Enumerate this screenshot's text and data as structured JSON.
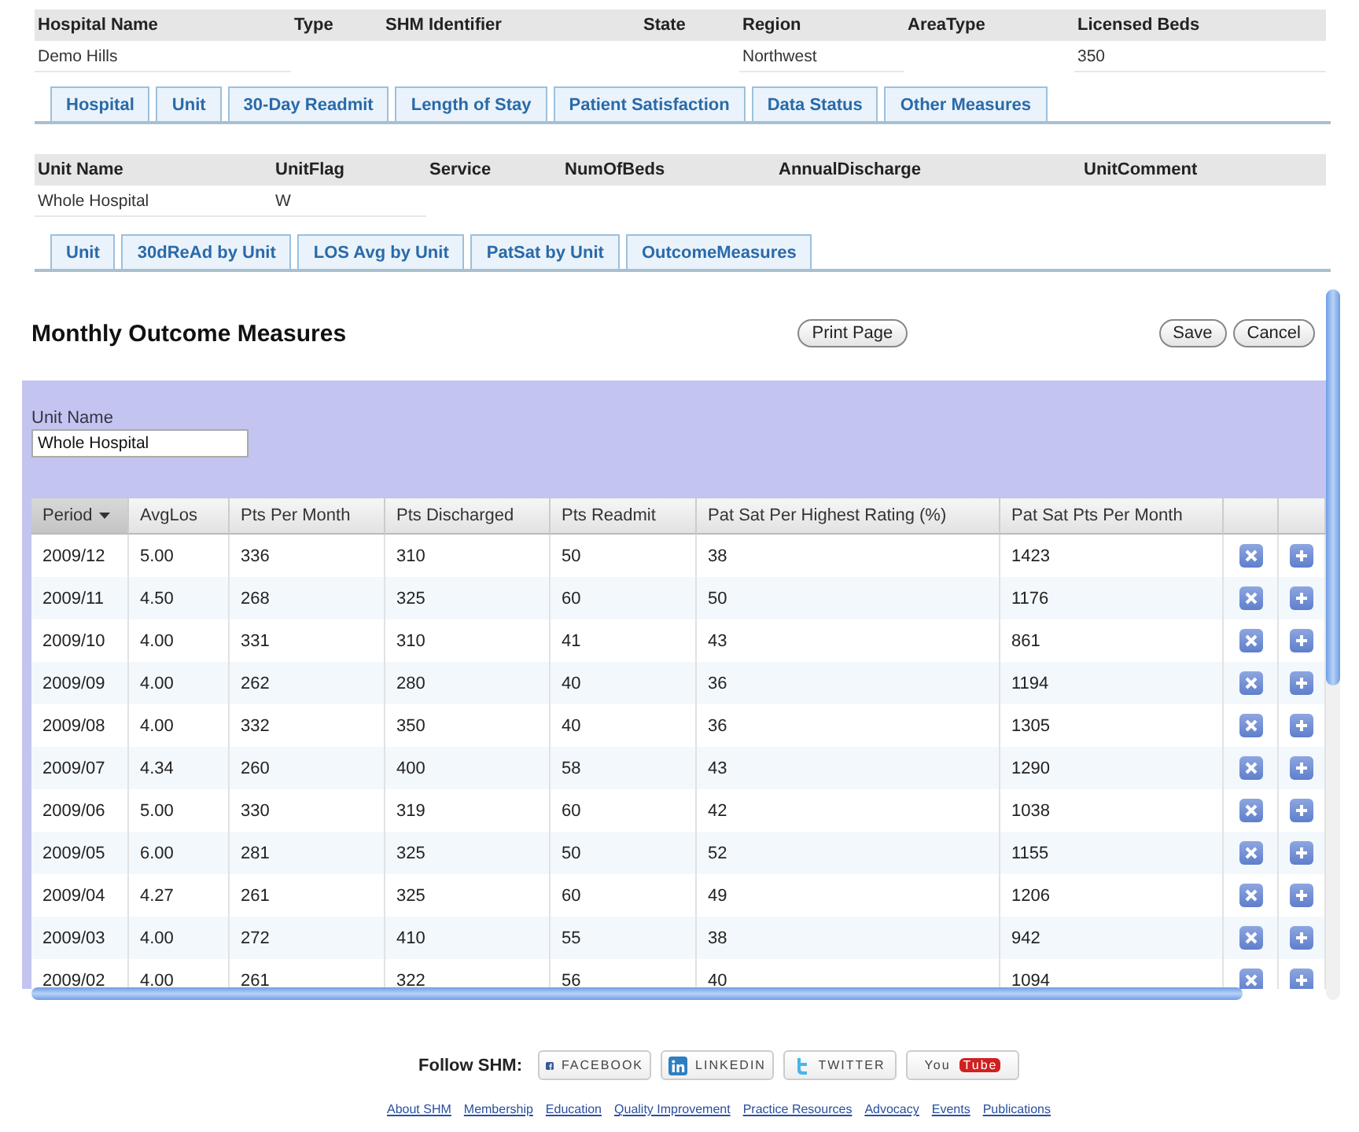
{
  "hospital": {
    "columns": [
      {
        "label": "Hospital Name",
        "value": "Demo Hills"
      },
      {
        "label": "Type"
      },
      {
        "label": "SHM Identifier"
      },
      {
        "label": "State"
      },
      {
        "label": "Region",
        "value": "Northwest"
      },
      {
        "label": "AreaType"
      },
      {
        "label": "Licensed Beds",
        "value": "350"
      }
    ]
  },
  "main_tabs": [
    {
      "label": "Hospital",
      "selected": false
    },
    {
      "label": "Unit",
      "selected": false
    },
    {
      "label": "30-Day Readmit",
      "selected": false
    },
    {
      "label": "Length of Stay",
      "selected": false
    },
    {
      "label": "Patient Satisfaction",
      "selected": false
    },
    {
      "label": "Data Status",
      "selected": false
    },
    {
      "label": "Other Measures",
      "selected": false
    }
  ],
  "unit": {
    "columns": [
      {
        "label": "Unit Name",
        "value": "Whole Hospital"
      },
      {
        "label": "UnitFlag",
        "value": "W"
      },
      {
        "label": "Service"
      },
      {
        "label": "NumOfBeds"
      },
      {
        "label": "AnnualDischarge"
      },
      {
        "label": "UnitComment"
      }
    ]
  },
  "unit_tabs": [
    {
      "label": "Unit",
      "selected": false
    },
    {
      "label": "30dReAd by Unit",
      "selected": false
    },
    {
      "label": "LOS Avg by Unit",
      "selected": false
    },
    {
      "label": "PatSat by Unit",
      "selected": false
    },
    {
      "label": "OutcomeMeasures",
      "selected": false
    }
  ],
  "panel": {
    "title": "Monthly Outcome Measures",
    "print_button": "Print Page",
    "buttons": [
      "Save",
      "Cancel"
    ],
    "unit_name_label": "Unit Name",
    "unit_name_value": "Whole Hospital",
    "table": {
      "columns": [
        {
          "label": "Period",
          "sorted": true
        },
        {
          "label": "AvgLos",
          "sorted": false
        },
        {
          "label": "Pts Per Month",
          "sorted": false
        },
        {
          "label": "Pts Discharged",
          "sorted": false
        },
        {
          "label": "Pts Readmit",
          "sorted": false
        },
        {
          "label": "Pat Sat Per Highest Rating (%)",
          "sorted": false
        },
        {
          "label": "Pat Sat Pts Per Month",
          "sorted": false
        }
      ],
      "rows": [
        [
          "2009/12",
          "5.00",
          "336",
          "310",
          "50",
          "38",
          "1423"
        ],
        [
          "2009/11",
          "4.50",
          "268",
          "325",
          "60",
          "50",
          "1176"
        ],
        [
          "2009/10",
          "4.00",
          "331",
          "310",
          "41",
          "43",
          "861"
        ],
        [
          "2009/09",
          "4.00",
          "262",
          "280",
          "40",
          "36",
          "1194"
        ],
        [
          "2009/08",
          "4.00",
          "332",
          "350",
          "40",
          "36",
          "1305"
        ],
        [
          "2009/07",
          "4.34",
          "260",
          "400",
          "58",
          "43",
          "1290"
        ],
        [
          "2009/06",
          "5.00",
          "330",
          "319",
          "60",
          "42",
          "1038"
        ],
        [
          "2009/05",
          "6.00",
          "281",
          "325",
          "50",
          "52",
          "1155"
        ],
        [
          "2009/04",
          "4.27",
          "261",
          "325",
          "60",
          "49",
          "1206"
        ],
        [
          "2009/03",
          "4.00",
          "272",
          "410",
          "55",
          "38",
          "942"
        ],
        [
          "2009/02",
          "4.00",
          "261",
          "322",
          "56",
          "40",
          "1094"
        ]
      ]
    }
  },
  "footer": {
    "follow_label": "Follow SHM:",
    "social": [
      {
        "kind": "facebook",
        "label": "FACEBOOK"
      },
      {
        "kind": "linkedin",
        "label": "LINKEDIN"
      },
      {
        "kind": "twitter",
        "label": "TWITTER"
      },
      {
        "kind": "youtube",
        "label": "You",
        "label_2": "Tube"
      }
    ],
    "links": [
      "About SHM",
      "Membership",
      "Education",
      "Quality Improvement",
      "Practice Resources",
      "Advocacy",
      "Events",
      "Publications"
    ]
  }
}
